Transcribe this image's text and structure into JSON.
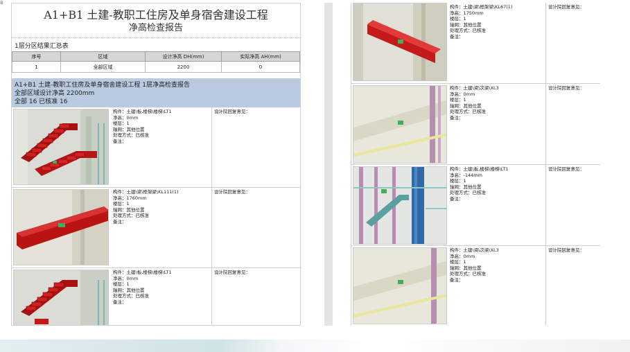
{
  "report": {
    "title": "A1+B1 土建-教职工住房及单身宿舍建设工程",
    "subtitle": "净高检查报告"
  },
  "summary": {
    "heading": "1层分区结果汇总表",
    "columns": [
      "序号",
      "区域",
      "设计净高 DH(mm)",
      "实际净高 AH(mm)"
    ],
    "rows": [
      [
        "1",
        "全部区域",
        "2200",
        "0"
      ]
    ]
  },
  "section": {
    "line1": "A1+B1 土建-教职工住房及单身宿舍建设工程 1层净高检查报告",
    "line2": "全部区域设计净高 2200mm",
    "line3": "全部  16  已核准  16"
  },
  "left_items": [
    {
      "component": "构件：土建\\板,楼梯\\楼梯\\LT1",
      "height": "净高：0mm",
      "floor": "楼层：1",
      "axis": "轴网：其他位置",
      "method": "处理方式：已核准",
      "remark": "备注：",
      "reply": "设计院回复意见："
    },
    {
      "component": "构件：土建\\梁\\框架梁\\KL111(1)",
      "height": "净高：1760mm",
      "floor": "楼层：1",
      "axis": "轴网：其他位置",
      "method": "处理方式：已核准",
      "remark": "备注：",
      "reply": "设计院回复意见："
    },
    {
      "component": "构件：土建\\板,楼梯\\楼梯\\LT1",
      "height": "净高：0mm",
      "floor": "楼层：1",
      "axis": "轴网：其他位置",
      "method": "处理方式：已核准",
      "remark": "备注：",
      "reply": "设计院回复意见："
    }
  ],
  "right_items": [
    {
      "component": "构件：土建\\梁\\框架梁\\KL67(1)",
      "height": "净高：1750mm",
      "floor": "楼层：1",
      "axis": "轴网：其他位置",
      "method": "处理方式：已核准",
      "remark": "备注：",
      "reply": "设计院回复意见："
    },
    {
      "component": "构件：土建\\梁\\次梁\\XL3",
      "height": "净高：0mm",
      "floor": "楼层：1",
      "axis": "轴网：其他位置",
      "method": "处理方式：已核准",
      "remark": "备注：",
      "reply": "设计院回复意见："
    },
    {
      "component": "构件：土建\\板,楼梯\\楼梯\\LT1",
      "height": "净高：-144mm",
      "floor": "楼层：1",
      "axis": "轴网：其他位置",
      "method": "处理方式：已核准",
      "remark": "备注：",
      "reply": "设计院回复意见："
    },
    {
      "component": "构件：土建\\梁\\次梁\\XL3",
      "height": "净高：0mm",
      "floor": "楼层：1",
      "axis": "轴网：其他位置",
      "method": "处理方式：已核准",
      "remark": "备注：",
      "reply": "设计院回复意见："
    }
  ],
  "colors": {
    "band": "#b8cbe0",
    "accent_red": "#e01010",
    "beam_red": "#c41a1a"
  },
  "corner": "B"
}
